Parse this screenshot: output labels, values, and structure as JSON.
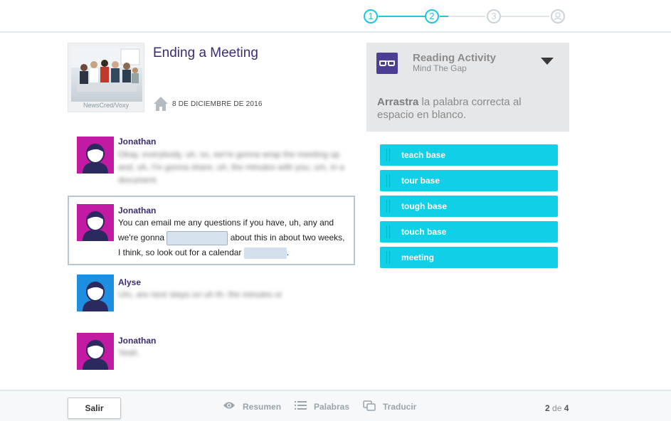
{
  "stepper": {
    "steps": [
      "1",
      "2",
      "3",
      ""
    ],
    "current": 2
  },
  "article": {
    "title": "Ending a Meeting",
    "date": "8 DE DICIEMBRE DE 2016",
    "photo_credit": "NewsCred/Voxy"
  },
  "transcript": [
    {
      "speaker": "Jonathan",
      "text": "Okay, everybody, uh, so, we're gonna wrap the meeting up and, uh, I'm gonna share, uh, the minutes with you, um, in a document.",
      "blurred": true,
      "avatar_color": "#c21aa3"
    },
    {
      "speaker": "Jonathan",
      "text_part1": "You can email me any questions if you have, uh, any and we're gonna",
      "text_part2": "about this in about two weeks, I think, so look out for a calendar",
      "text_part3": ".",
      "blurred": false,
      "avatar_color": "#c21aa3"
    },
    {
      "speaker": "Alyse",
      "text": "Um, are next steps on uh th- the minutes or",
      "blurred": true,
      "avatar_color": "#1e8fe0"
    },
    {
      "speaker": "Jonathan",
      "text": "Yeah.",
      "blurred": true,
      "avatar_color": "#c21aa3"
    }
  ],
  "activity": {
    "title": "Reading Activity",
    "subtitle": "Mind The Gap",
    "instruction_bold": "Arrastra",
    "instruction_rest": " la palabra correcta al espacio en blanco.",
    "icon": "glasses-icon"
  },
  "choices": [
    "teach base",
    "tour base",
    "tough base",
    "touch base",
    "meeting"
  ],
  "bottom": {
    "exit_label": "Salir",
    "summary_label": "Resumen",
    "words_label": "Palabras",
    "translate_label": "Traducir",
    "page_current": "2",
    "page_sep": "de",
    "page_total": "4"
  },
  "colors": {
    "accent": "#12cfe8",
    "title_purple": "#3d2a78",
    "avatar_magenta": "#c21aa3",
    "avatar_blue": "#1e8fe0"
  }
}
